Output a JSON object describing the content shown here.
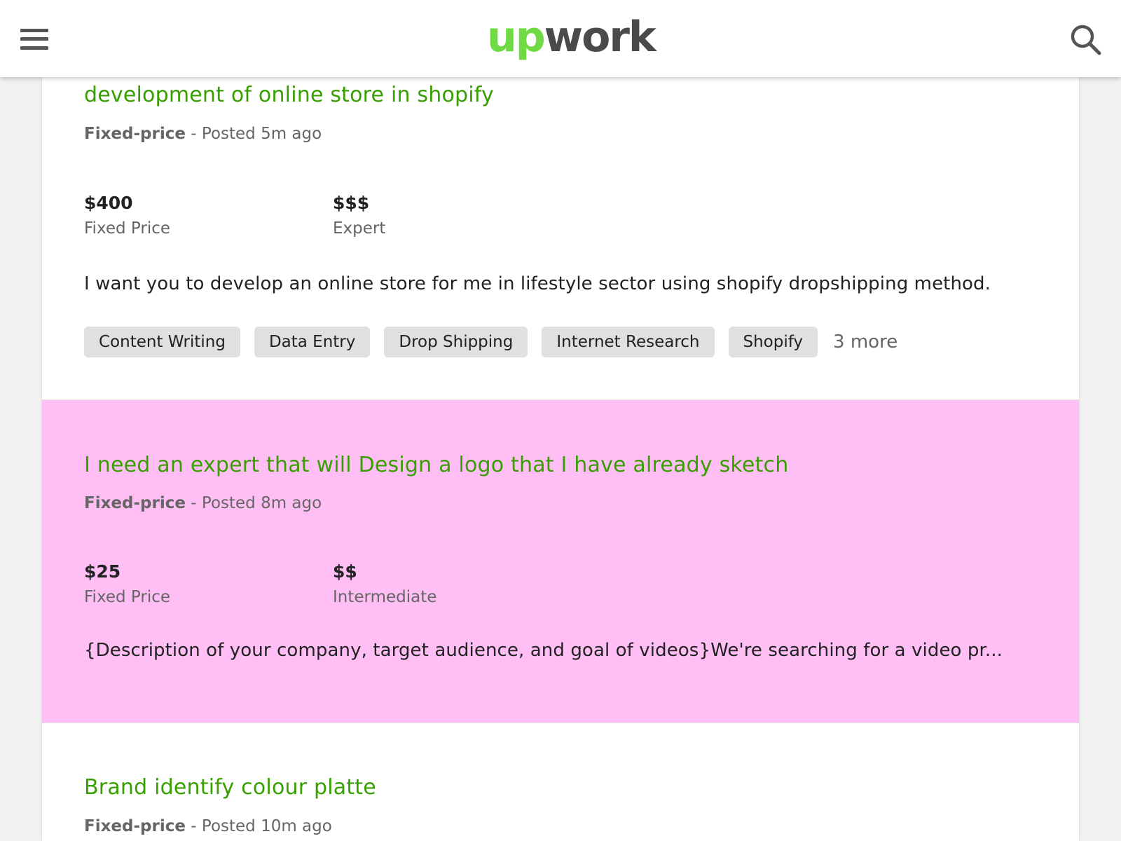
{
  "header": {
    "logo_up": "up",
    "logo_work": "work",
    "brand_color": "#6fda44"
  },
  "jobs": [
    {
      "title": "development of online store in shopify",
      "type": "Fixed-price",
      "posted": "- Posted 5m ago",
      "price": "$400",
      "price_label": "Fixed Price",
      "level": "$$$",
      "level_label": "Expert",
      "description": "I want you to develop an online store for me in lifestyle sector using shopify dropshipping method.",
      "tags": [
        "Content Writing",
        "Data Entry",
        "Drop Shipping",
        "Internet Research",
        "Shopify"
      ],
      "more": "3 more"
    },
    {
      "title": "I need an expert that will Design a logo that I have already sketch",
      "type": "Fixed-price",
      "posted": "- Posted 8m ago",
      "price": "$25",
      "price_label": "Fixed Price",
      "level": "$$",
      "level_label": "Intermediate",
      "description": "{Description of your company, target audience, and goal of videos}We're searching for a video pr...",
      "highlight_color": "#ffbff5"
    },
    {
      "title": "Brand identify colour platte",
      "type": "Fixed-price",
      "posted": "- Posted 10m ago"
    }
  ],
  "icons": {
    "menu": "hamburger-menu-icon",
    "search": "search-icon"
  }
}
